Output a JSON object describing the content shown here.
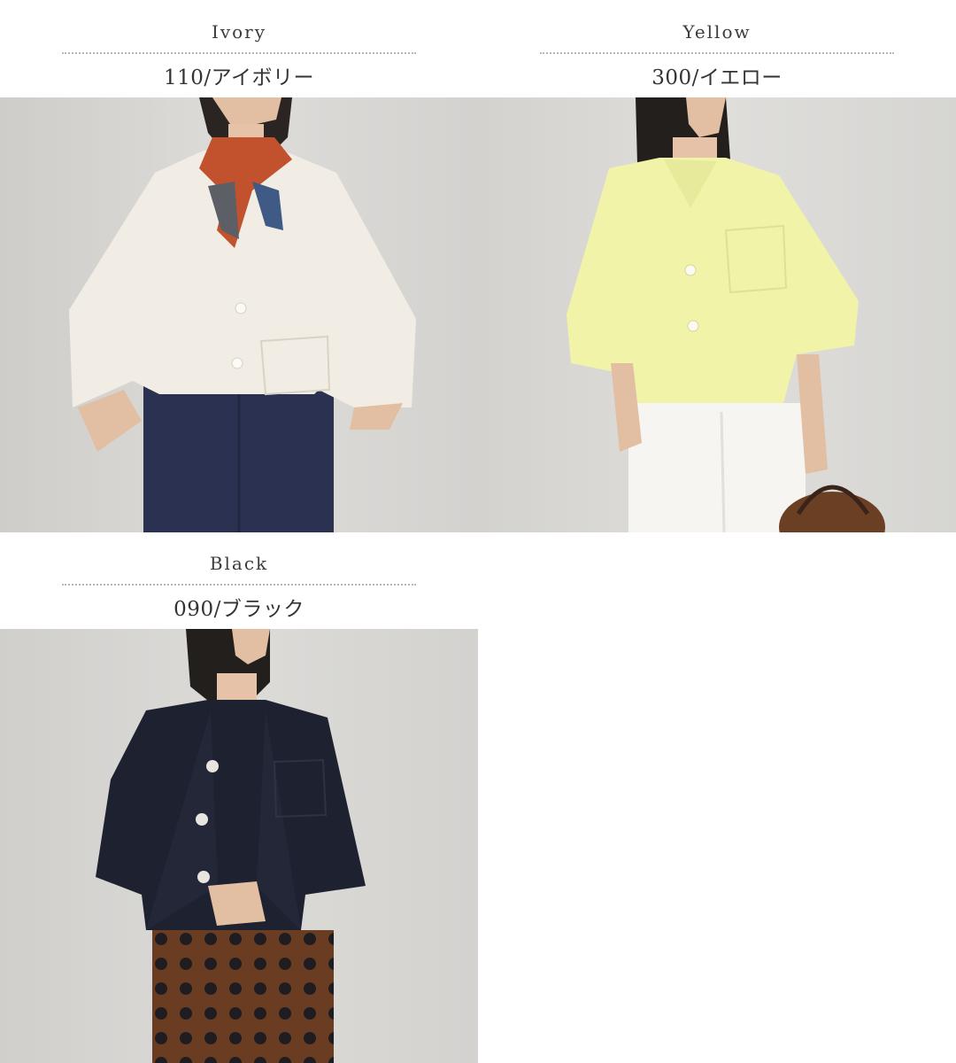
{
  "variants": [
    {
      "en": "Ivory",
      "code": "110/アイボリー",
      "photo": "model wearing ivory cropped open-collar linen shirt with scarf and denim trousers"
    },
    {
      "en": "Yellow",
      "code": "300/イエロー",
      "photo": "model wearing yellow cropped open-collar linen shirt with white trousers and basket bag"
    },
    {
      "en": "Black",
      "code": "090/ブラック",
      "photo": "model wearing black cropped open-collar linen shirt with white tank and patterned trousers"
    }
  ],
  "colors": {
    "ivory_shirt": "#f1ede4",
    "yellow_shirt": "#f1f3a8",
    "black_shirt": "#1e2130",
    "backdrop": "#d8d7d4",
    "label_text": "#333333",
    "divider": "#b9b9b9"
  }
}
